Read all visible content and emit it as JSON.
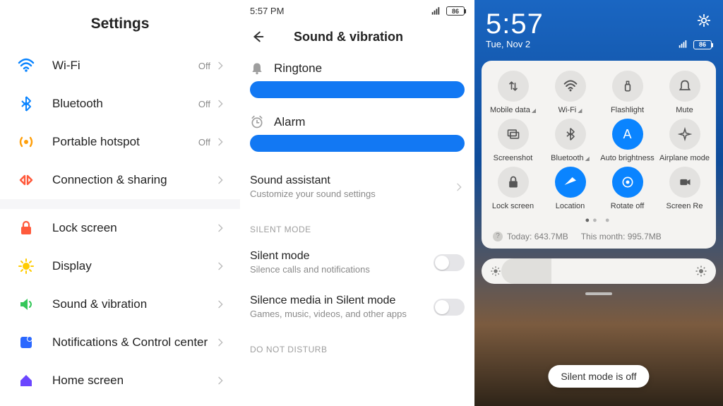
{
  "settings": {
    "title": "Settings",
    "group1": [
      {
        "icon": "wifi",
        "iconColor": "#0a84ff",
        "label": "Wi-Fi",
        "state": "Off"
      },
      {
        "icon": "bluetooth",
        "iconColor": "#0a84ff",
        "label": "Bluetooth",
        "state": "Off"
      },
      {
        "icon": "hotspot",
        "iconColor": "#ff9f0a",
        "label": "Portable hotspot",
        "state": "Off"
      },
      {
        "icon": "sharing",
        "iconColor": "#ff5a3c",
        "label": "Connection & sharing",
        "state": ""
      }
    ],
    "group2": [
      {
        "icon": "lock",
        "iconColor": "#ff5a3c",
        "label": "Lock screen"
      },
      {
        "icon": "display",
        "iconColor": "#ffcc00",
        "label": "Display"
      },
      {
        "icon": "sound",
        "iconColor": "#34c759",
        "label": "Sound & vibration"
      },
      {
        "icon": "notif",
        "iconColor": "#2b68ff",
        "label": "Notifications & Control center"
      },
      {
        "icon": "home",
        "iconColor": "#6b46ff",
        "label": "Home screen"
      }
    ]
  },
  "sound": {
    "status_time": "5:57 PM",
    "battery": "86",
    "title": "Sound & vibration",
    "ringtone_label": "Ringtone",
    "alarm_label": "Alarm",
    "assistant_label": "Sound assistant",
    "assistant_sub": "Customize your sound settings",
    "silent_header": "SILENT MODE",
    "silent_label": "Silent mode",
    "silent_sub": "Silence calls and notifications",
    "media_label": "Silence media in Silent mode",
    "media_sub": "Games, music, videos, and other apps",
    "dnd_header": "DO NOT DISTURB"
  },
  "shade": {
    "clock": "5:57",
    "date": "Tue, Nov 2",
    "battery": "86",
    "tiles": [
      {
        "icon": "data",
        "label": "Mobile data",
        "on": false,
        "hasSub": true
      },
      {
        "icon": "wifi",
        "label": "Wi-Fi",
        "on": false,
        "hasSub": true
      },
      {
        "icon": "flash",
        "label": "Flashlight",
        "on": false
      },
      {
        "icon": "mute",
        "label": "Mute",
        "on": false
      },
      {
        "icon": "shot",
        "label": "Screenshot",
        "on": false
      },
      {
        "icon": "bluetooth",
        "label": "Bluetooth",
        "on": false,
        "hasSub": true
      },
      {
        "icon": "autobr",
        "label": "Auto brightness",
        "on": true
      },
      {
        "icon": "plane",
        "label": "Airplane mode",
        "on": false
      },
      {
        "icon": "lock",
        "label": "Lock screen",
        "on": false
      },
      {
        "icon": "location",
        "label": "Location",
        "on": true
      },
      {
        "icon": "rotate",
        "label": "Rotate off",
        "on": true
      },
      {
        "icon": "rec",
        "label": "Screen Re",
        "on": false
      }
    ],
    "usage_today": "Today: 643.7MB",
    "usage_month": "This month: 995.7MB",
    "toast": "Silent mode is off"
  }
}
